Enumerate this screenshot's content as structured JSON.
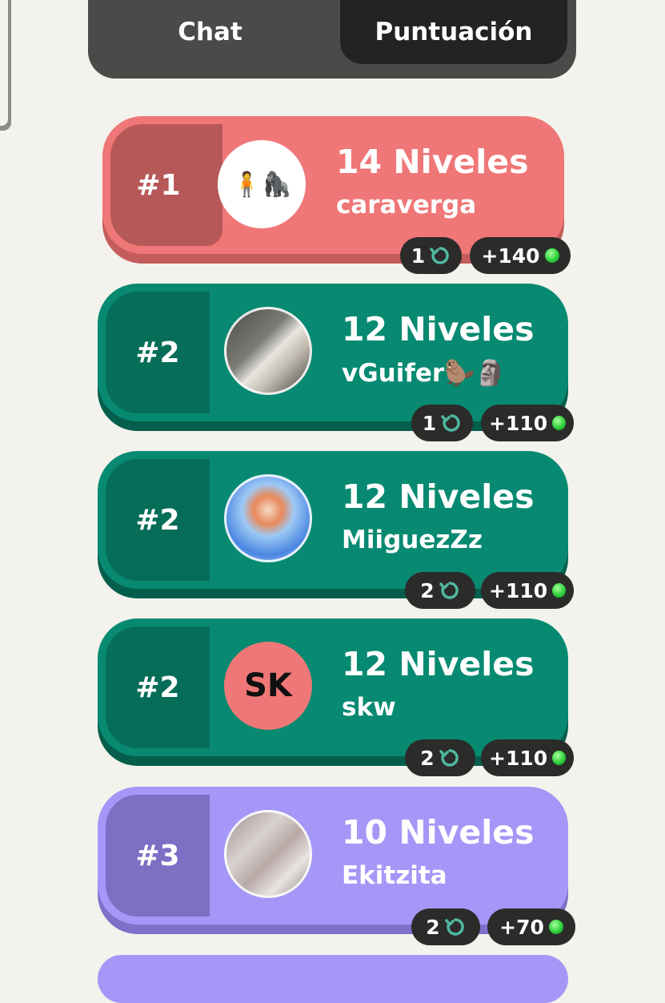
{
  "tabs": {
    "chat": "Chat",
    "score": "Puntuación",
    "active": "score"
  },
  "colors": {
    "red": "#f07777",
    "red_dark": "#b75858",
    "red_shadow": "#c45c5c",
    "green": "#078a71",
    "green_dark": "#066d59",
    "green_shadow": "#055e4c",
    "purple": "#a597f7",
    "purple_dark": "#7c6fc4",
    "purple_shadow": "#7d70c9"
  },
  "leaderboard": [
    {
      "rank": "#1",
      "levels": "14 Niveles",
      "username": "caraverga",
      "attempts": "1",
      "points": "+140",
      "avatar": "emoji-pair-avatar",
      "avatar_initials": "",
      "avatar_emoji": "🧍🦍"
    },
    {
      "rank": "#2",
      "levels": "12 Niveles",
      "username": "vGuifer🦫🗿",
      "attempts": "1",
      "points": "+110",
      "avatar": "photo-avatar",
      "avatar_initials": "",
      "avatar_emoji": ""
    },
    {
      "rank": "#2",
      "levels": "12 Niveles",
      "username": "MiiguezZz",
      "attempts": "2",
      "points": "+110",
      "avatar": "anime-avatar",
      "avatar_initials": "",
      "avatar_emoji": ""
    },
    {
      "rank": "#2",
      "levels": "12 Niveles",
      "username": "skw",
      "attempts": "2",
      "points": "+110",
      "avatar": "initials-avatar",
      "avatar_initials": "SK",
      "avatar_emoji": ""
    },
    {
      "rank": "#3",
      "levels": "10 Niveles",
      "username": "Ekitzita",
      "attempts": "2",
      "points": "+70",
      "avatar": "photo-avatar",
      "avatar_initials": "",
      "avatar_emoji": ""
    }
  ]
}
